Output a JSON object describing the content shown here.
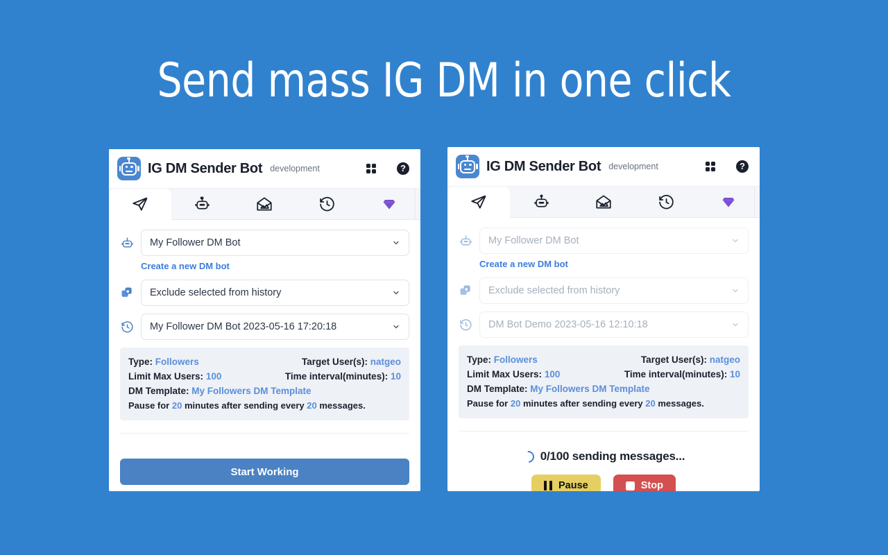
{
  "page": {
    "background_color": "#3182ce",
    "headline": "Send mass IG DM in one click"
  },
  "app": {
    "logo_icon": "robot-logo-icon",
    "title": "IG DM Sender Bot",
    "env_badge": "development",
    "grid_icon": "grid-apps-icon",
    "help_icon": "help-question-icon",
    "help_glyph": "?"
  },
  "tabs": [
    {
      "name": "send",
      "icon": "paper-plane-icon",
      "active": true
    },
    {
      "name": "bots",
      "icon": "robot-icon",
      "active": false
    },
    {
      "name": "templates",
      "icon": "open-envelope-image-icon",
      "active": false
    },
    {
      "name": "history",
      "icon": "history-clock-icon",
      "active": false
    },
    {
      "name": "premium",
      "icon": "diamond-gem-icon",
      "active": false
    }
  ],
  "left_panel": {
    "state": "idle",
    "bot_select": {
      "icon": "robot-head-icon",
      "value": "My Follower DM Bot",
      "chevron": "chevron-down-icon"
    },
    "create_link": "Create a new DM bot",
    "exclude_select": {
      "icon": "copy-duplicate-icon",
      "value": "Exclude selected from history",
      "chevron": "chevron-down-icon"
    },
    "history_select": {
      "icon": "clock-rotate-icon",
      "value": "My Follower DM Bot 2023-05-16 17:20:18",
      "chevron": "chevron-down-icon"
    },
    "info": {
      "type_label": "Type:",
      "type_value": "Followers",
      "target_label": "Target User(s):",
      "target_value": "natgeo",
      "limit_label": "Limit Max Users:",
      "limit_value": "100",
      "interval_label": "Time interval(minutes):",
      "interval_value": "10",
      "template_label": "DM Template:",
      "template_value": "My Followers DM Template",
      "pause_prefix": "Pause for",
      "pause_minutes": "20",
      "pause_middle": "minutes after sending every",
      "pause_count": "20",
      "pause_suffix": "messages."
    },
    "start_button": "Start Working"
  },
  "right_panel": {
    "state": "running",
    "bot_select": {
      "icon": "robot-head-icon",
      "value": "My Follower DM Bot",
      "chevron": "chevron-down-icon"
    },
    "create_link": "Create a new DM bot",
    "exclude_select": {
      "icon": "copy-duplicate-icon",
      "value": "Exclude selected from history",
      "chevron": "chevron-down-icon"
    },
    "history_select": {
      "icon": "clock-rotate-icon",
      "value": "DM Bot Demo 2023-05-16 12:10:18",
      "chevron": "chevron-down-icon"
    },
    "info": {
      "type_label": "Type:",
      "type_value": "Followers",
      "target_label": "Target User(s):",
      "target_value": "natgeo",
      "limit_label": "Limit Max Users:",
      "limit_value": "100",
      "interval_label": "Time interval(minutes):",
      "interval_value": "10",
      "template_label": "DM Template:",
      "template_value": "My Followers DM Template",
      "pause_prefix": "Pause for",
      "pause_minutes": "20",
      "pause_middle": "minutes after sending every",
      "pause_count": "20",
      "pause_suffix": "messages."
    },
    "status": {
      "spinner_icon": "loading-spinner-icon",
      "text": "0/100 sending messages...",
      "sent": 0,
      "total": 100
    },
    "pause_button": {
      "label": "Pause",
      "icon": "pause-icon",
      "color": "#e6cf62"
    },
    "stop_button": {
      "label": "Stop",
      "icon": "stop-square-icon",
      "color": "#d44f4f"
    }
  },
  "colors": {
    "background": "#3182ce",
    "primary": "#4a82c4",
    "link": "#3b7ddd",
    "info_value": "#5b8fd9",
    "info_bg": "#eef1f6",
    "gem": "#7b4fd6"
  }
}
